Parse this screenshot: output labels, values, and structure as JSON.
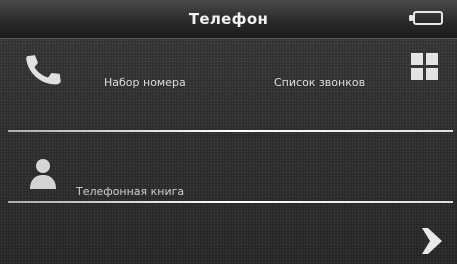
{
  "header": {
    "title": "Телефон",
    "battery_icon": "battery-icon"
  },
  "menu": {
    "dial_label": "Набор номера",
    "dial_icon": "phone-handset-icon",
    "calls_label": "Список звонков",
    "calls_icon": "grid-icon",
    "book_label": "Телефонная книга",
    "book_icon": "person-icon"
  },
  "footer": {
    "next_icon": "next-arrow-icon"
  },
  "colors": {
    "background": "#2c2c2c",
    "header": "#2a2a2a",
    "text": "#e6e6e6",
    "divider": "#ffffff"
  }
}
